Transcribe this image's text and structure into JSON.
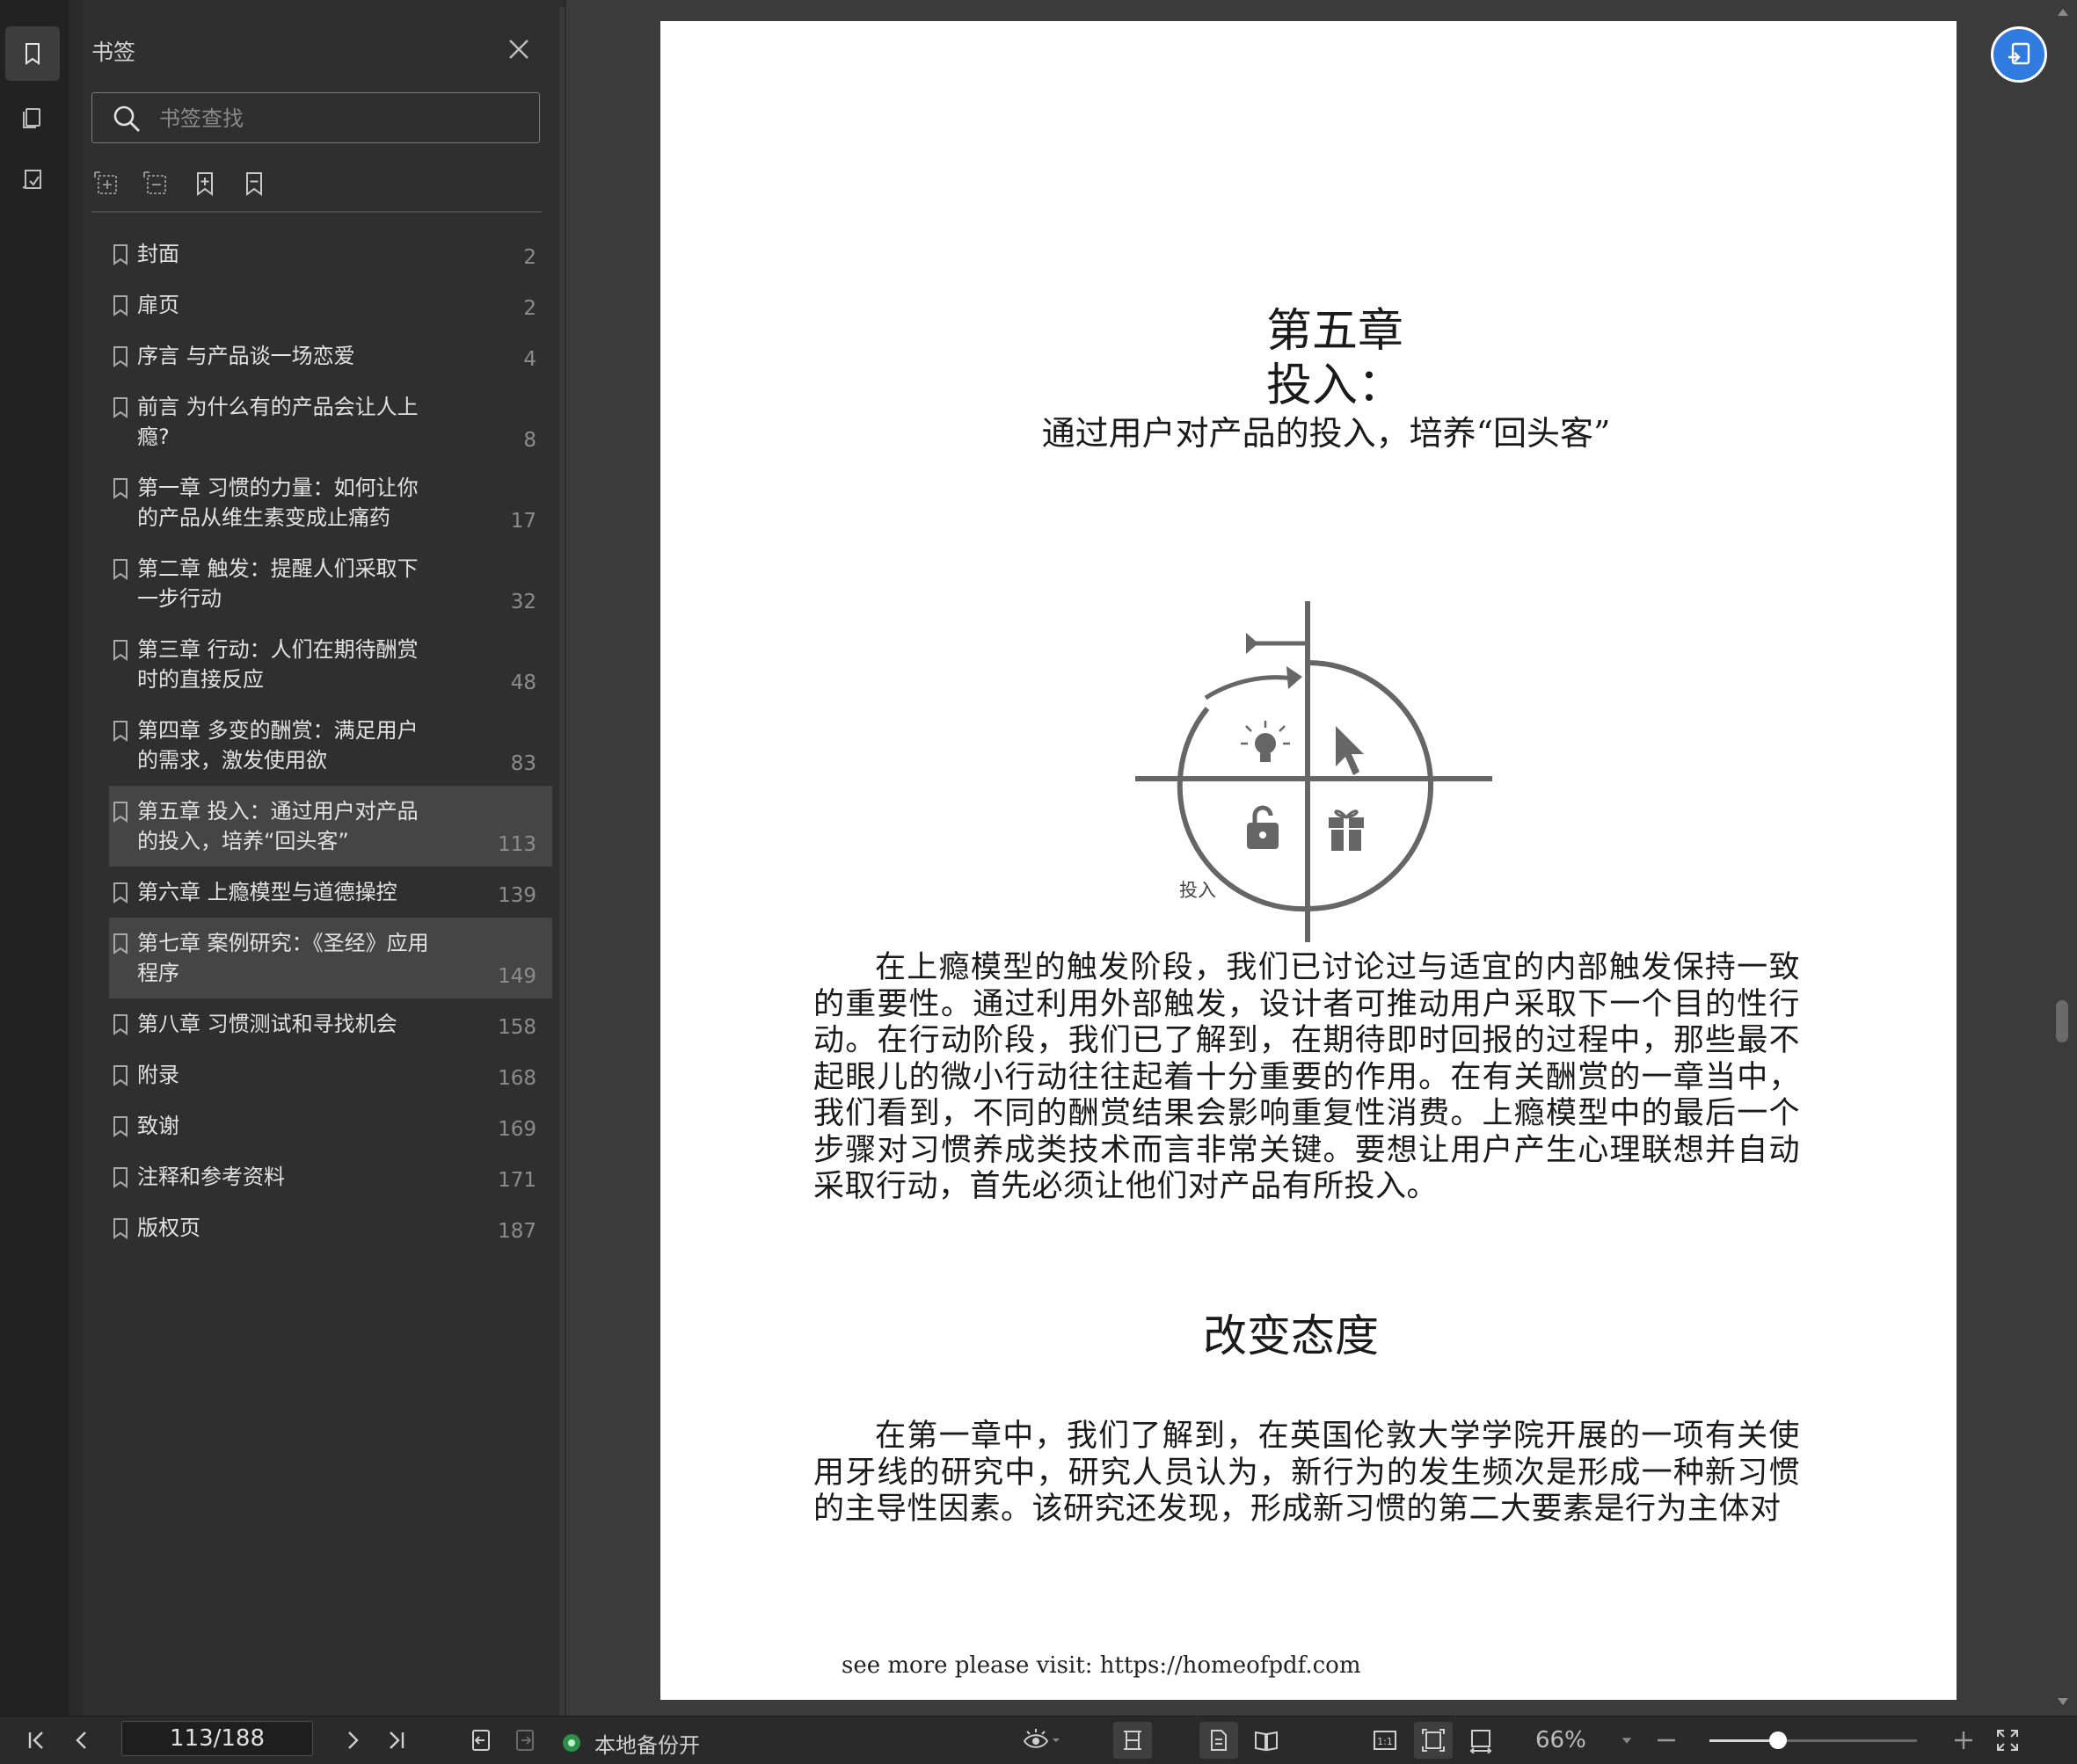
{
  "sidebar_rail": {
    "items": [
      {
        "name": "bookmark-tab-icon"
      },
      {
        "name": "thumbnail-tab-icon"
      },
      {
        "name": "annotation-tab-icon"
      }
    ]
  },
  "panel": {
    "title": "书签",
    "search_placeholder": "书签查找",
    "toolbar": [
      "expand-all-icon",
      "collapse-all-icon",
      "add-bookmark-icon",
      "remove-bookmark-icon"
    ]
  },
  "bookmarks": [
    {
      "label": "封面",
      "page": "2"
    },
    {
      "label": "扉页",
      "page": "2"
    },
    {
      "label": "序言 与产品谈一场恋爱",
      "page": "4"
    },
    {
      "label": "前言 为什么有的产品会让人上瘾?",
      "page": "8"
    },
    {
      "label": "第一章 习惯的力量：如何让你的产品从维生素变成止痛药",
      "page": "17"
    },
    {
      "label": "第二章 触发：提醒人们采取下一步行动",
      "page": "32"
    },
    {
      "label": "第三章 行动：人们在期待酬赏时的直接反应",
      "page": "48"
    },
    {
      "label": "第四章 多变的酬赏：满足用户的需求，激发使用欲",
      "page": "83"
    },
    {
      "label": "第五章 投入：通过用户对产品的投入，培养“回头客”",
      "page": "113"
    },
    {
      "label": "第六章 上瘾模型与道德操控",
      "page": "139"
    },
    {
      "label": "第七章 案例研究：《圣经》应用程序",
      "page": "149"
    },
    {
      "label": "第八章 习惯测试和寻找机会",
      "page": "158"
    },
    {
      "label": "附录",
      "page": "168"
    },
    {
      "label": "致谢",
      "page": "169"
    },
    {
      "label": "注释和参考资料",
      "page": "171"
    },
    {
      "label": "版权页",
      "page": "187"
    }
  ],
  "document": {
    "chapter_number": "第五章",
    "chapter_heading": "投入：",
    "chapter_subtitle": "通过用户对产品的投入，培养“回头客”",
    "diagram_label": "投入",
    "paragraph1": "在上瘾模型的触发阶段，我们已讨论过与适宜的内部触发保持一致的重要性。通过利用外部触发，设计者可推动用户采取下一个目的性行动。在行动阶段，我们已了解到，在期待即时回报的过程中，那些最不起眼儿的微小行动往往起着十分重要的作用。在有关酬赏的一章当中，我们看到，不同的酬赏结果会影响重复性消费。上瘾模型中的最后一个步骤对习惯养成类技术而言非常关键。要想让用户产生心理联想并自动采取行动，首先必须让他们对产品有所投入。",
    "section_title": "改变态度",
    "paragraph2": "在第一章中，我们了解到，在英国伦敦大学学院开展的一项有关使用牙线的研究中，研究人员认为，新行为的发生频次是形成一种新习惯的主导性因素。该研究还发现，形成新习惯的第二大要素是行为主体对",
    "footer": "see more please visit: https://homeofpdf.com"
  },
  "statusbar": {
    "page_indicator": "113/188",
    "backup_status": "本地备份开",
    "zoom": "66%",
    "zoom_level": 0.33
  },
  "colors": {
    "accent": "#2f7be0",
    "status_ok": "#2d8f4a",
    "panel_bg": "#2f2f2f",
    "selected_row": "#454545"
  }
}
